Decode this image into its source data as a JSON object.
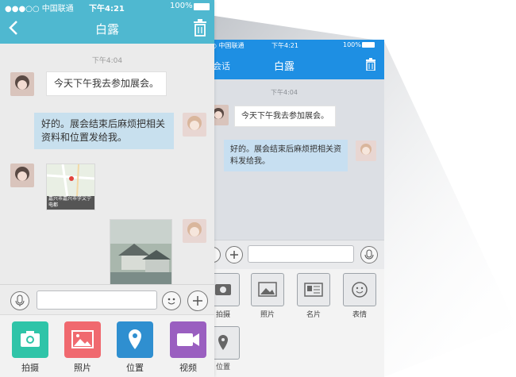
{
  "status_bar": {
    "carrier": "●●●○○ 中国联通",
    "time": "下午4:21",
    "battery": "100%"
  },
  "front": {
    "title": "白露",
    "timestamp": "下午4:04",
    "msg_incoming": "今天下午我去参加展会。",
    "msg_outgoing": "好的。展会结束后麻烦把相关资料和位置发给我。",
    "map_caption": "嘉兴市嘉兴市学文宁电都",
    "panel": [
      {
        "label": "拍摄",
        "color": "#2fc4a8",
        "icon": "camera-icon"
      },
      {
        "label": "照片",
        "color": "#f0696f",
        "icon": "photo-icon"
      },
      {
        "label": "位置",
        "color": "#2f8fd0",
        "icon": "location-icon"
      },
      {
        "label": "视频",
        "color": "#9a5fc0",
        "icon": "video-icon"
      }
    ]
  },
  "back": {
    "title": "白露",
    "back_label": "会话",
    "timestamp": "下午4:04",
    "msg_incoming": "今天下午我去参加展会。",
    "msg_outgoing": "好的。展会结束后麻烦把相关资料发给我。",
    "panel": [
      {
        "label": "拍摄",
        "icon": "camera-icon"
      },
      {
        "label": "照片",
        "icon": "photo-icon"
      },
      {
        "label": "名片",
        "icon": "card-icon"
      },
      {
        "label": "表情",
        "icon": "emoji-icon"
      },
      {
        "label": "位置",
        "icon": "location-icon"
      }
    ]
  },
  "colors": {
    "front_bar": "#4fb8d0",
    "back_bar": "#1e8fe3",
    "bubble_out": "#c8e0ee"
  }
}
